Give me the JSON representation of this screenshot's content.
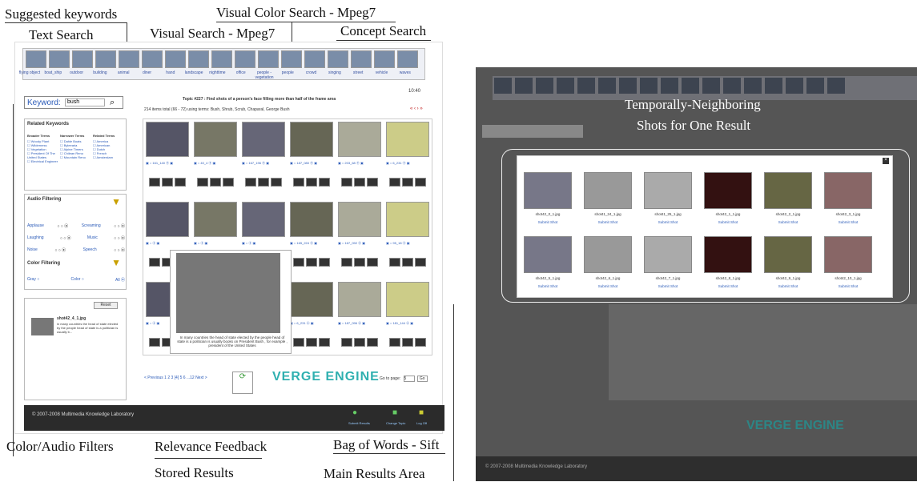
{
  "captions": {
    "suggested": "Suggested keywords",
    "text_search": "Text Search",
    "color_search": "Visual Color Search - Mpeg7",
    "visual_search": "Visual Search - Mpeg7",
    "concept_search": "Concept Search",
    "filters": "Color/Audio Filters",
    "relevance": "Relevance Feedback",
    "bow": "Bag of Words - Sift",
    "stored": "Stored Results",
    "main": "Main Results Area",
    "temporal_line1": "Temporally-Neighboring",
    "temporal_line2": "Shots for One Result"
  },
  "concepts": [
    "flying object",
    "boat_ship",
    "outdoor",
    "building",
    "animal",
    "diner",
    "hand",
    "landscape",
    "nighttime",
    "office",
    "people - vegetation",
    "people",
    "crowd",
    "singing",
    "street",
    "vehicle",
    "waves"
  ],
  "clock": "10:40",
  "keyword": {
    "label": "Keyword:",
    "value": "bush"
  },
  "related": {
    "title": "Related Keywords",
    "cols": [
      "Broader Terms",
      "Narrower Terms",
      "Related Terms"
    ],
    "broader": [
      "Woody Plant",
      "Wilderness",
      "Vegetation",
      "President Of The United States",
      "Electrical Engineer"
    ],
    "narrower": [
      "Dahle Boats",
      "Byleearia",
      "Alpine Timers",
      "Chilean Reno",
      "Mountain Reno"
    ],
    "relterms": [
      "America",
      "American",
      "Dutch",
      "French",
      "Amsterdam"
    ]
  },
  "audio": {
    "title": "Audio Filtering",
    "rows": [
      "Applause",
      "Laughing",
      "Noise"
    ],
    "rows2": [
      "Screaming",
      "Music",
      "Speech"
    ]
  },
  "color": {
    "title": "Color Filtering",
    "opts": [
      "Gray",
      "Color",
      "All"
    ]
  },
  "topic": "Topic #227 : Find shots of a person's face filling more than half of the frame area",
  "items": "214 items total (66 - 72) using terms: Bush, Shrub, Scrub, Chaparal, George Bush",
  "result_ids": [
    "161_140",
    "40_4",
    "167_196",
    "187_080",
    "203_68",
    "6_231",
    "",
    "",
    "",
    "165_224",
    "167_092",
    "95_18",
    "",
    "",
    "",
    "6_231",
    "187_096",
    "181_144"
  ],
  "popup_text": "In many countries the head of state elected by the people head of state is a politician is usually books on President Bush , for example , president of the United States",
  "stored": {
    "reset": "Reset",
    "file": "shot42_4_1.jpg",
    "text": "in many countries the head of state elected by the people head of state is a politician is usually b..."
  },
  "pager": "< Previous 1 2 3 [4] 5 6 ...12 Next >",
  "goto": {
    "label": "Go to page:",
    "value": "5",
    "button": "Go"
  },
  "logo": "VERGE ENGINE",
  "footer": {
    "copy": "© 2007-2008 Multimedia Knowledge Laboratory",
    "a1": "Submit Results",
    "a2": "Change Topic",
    "a3": "Log Off"
  },
  "neighbors": [
    {
      "name": "shot42_0_1.jpg"
    },
    {
      "name": "shot41_24_1.jpg"
    },
    {
      "name": "shot41_25_1.jpg"
    },
    {
      "name": "shot42_1_1.jpg"
    },
    {
      "name": "shot42_2_1.jpg"
    },
    {
      "name": "shot42_3_1.jpg"
    },
    {
      "name": "shot42_5_1.jpg"
    },
    {
      "name": "shot42_6_1.jpg"
    },
    {
      "name": "shot42_7_1.jpg"
    },
    {
      "name": "shot42_8_1.jpg"
    },
    {
      "name": "shot42_9_1.jpg"
    },
    {
      "name": "shot42_10_1.jpg"
    }
  ],
  "submit_shot": "Submit Shot",
  "btn_labels": [
    "Col",
    "",
    "BoW"
  ]
}
